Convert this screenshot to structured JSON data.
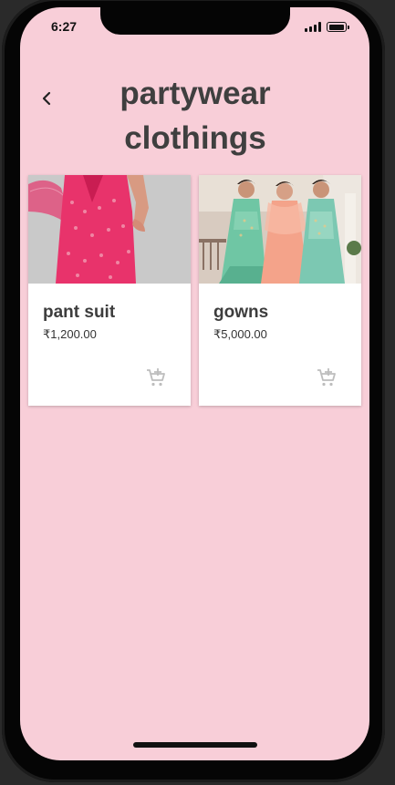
{
  "status": {
    "time": "6:27"
  },
  "header": {
    "title_line1": "partywear",
    "title_line2": "clothings"
  },
  "products": [
    {
      "name": "pant suit",
      "price": "₹1,200.00"
    },
    {
      "name": "gowns",
      "price": "₹5,000.00"
    }
  ],
  "icons": {
    "back": "chevron-left-icon",
    "cart": "add-shopping-cart-icon",
    "signal": "cellular-signal-icon",
    "battery": "battery-icon"
  },
  "colors": {
    "background": "#f8ced8",
    "card": "#ffffff",
    "title": "#3f3f3f",
    "cart_icon": "#bdbdbd"
  }
}
